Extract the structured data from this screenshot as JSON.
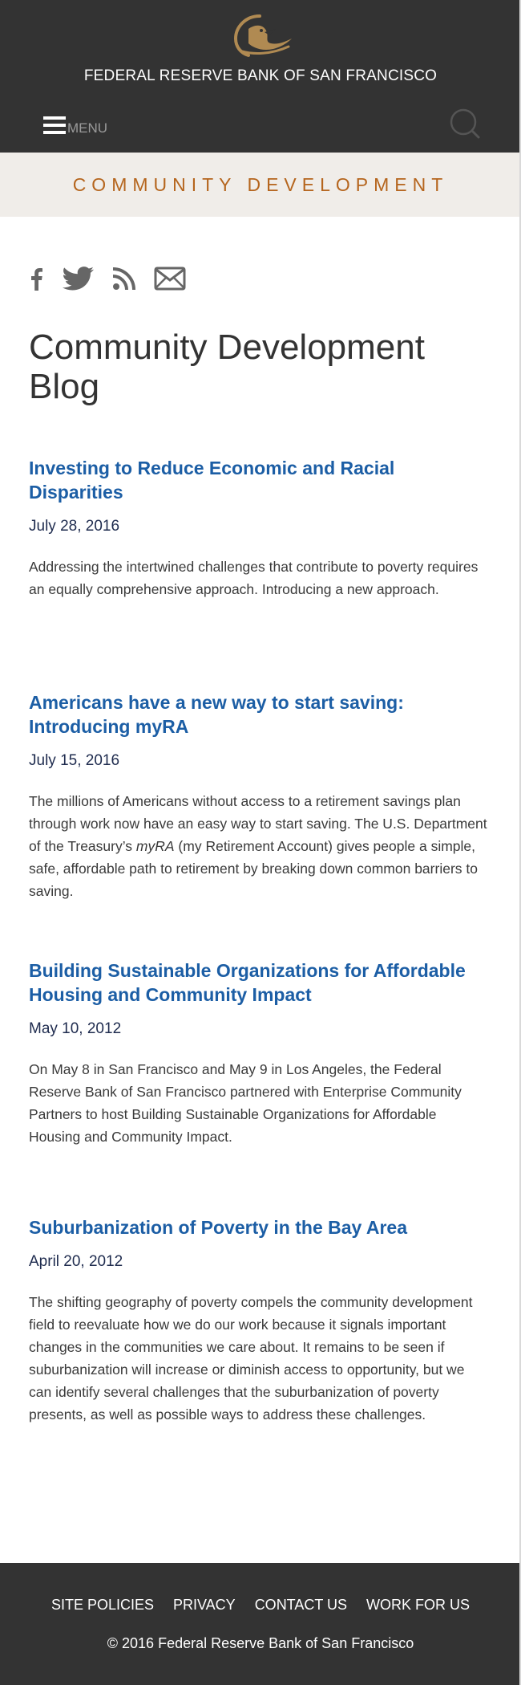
{
  "header": {
    "bank_name": "FEDERAL RESERVE BANK OF SAN FRANCISCO",
    "menu_label": "MENU",
    "logo_icon": "eagle-logo",
    "search_icon": "search-icon",
    "colors": {
      "background": "#333333",
      "logo": "#b08a52"
    }
  },
  "section": {
    "title": "COMMUNITY DEVELOPMENT",
    "colors": {
      "background": "#f0ede9",
      "text": "#b5651d"
    }
  },
  "social": {
    "icons": [
      "facebook-icon",
      "twitter-icon",
      "rss-icon",
      "email-icon"
    ]
  },
  "main": {
    "page_title": "Community Development Blog",
    "posts": [
      {
        "title": "Investing to Reduce Economic and Racial Disparities",
        "date": "July 28, 2016",
        "summary": "Addressing the intertwined challenges that contribute to poverty requires an equally comprehensive approach. Introducing a new approach."
      },
      {
        "title": "Americans have a new way to start saving: Introducing myRA",
        "date": "July 15, 2016",
        "summary_before": "The millions of Americans without access to a retirement savings plan through work now have an easy way to start saving. The U.S. Department of the Treasury’s ",
        "summary_em": "myRA",
        "summary_after": " (my Retirement Account) gives people a simple, safe, affordable path to retirement by breaking down common barriers to saving."
      },
      {
        "title": "Building Sustainable Organizations for Affordable Housing and Community Impact",
        "date": "May 10, 2012",
        "summary": "On May 8 in San Francisco and May 9 in Los Angeles, the Federal Reserve Bank of San Francisco partnered with Enterprise Community Partners to host Building Sustainable Organizations for Affordable Housing and Community Impact."
      },
      {
        "title": "Suburbanization of Poverty in the Bay Area",
        "date": "April 20, 2012",
        "summary": "The shifting geography of poverty compels the community development field to reevaluate how we do our work because it signals important changes in the communities we care about. It remains to be seen if suburbanization will increase or diminish access to opportunity, but we can identify several challenges that the suburbanization of poverty presents, as well as possible ways to address these challenges."
      }
    ],
    "colors": {
      "post_title": "#1c5ea5",
      "date": "#1e2b4e"
    }
  },
  "footer": {
    "links": [
      "SITE POLICIES",
      "PRIVACY",
      "CONTACT US",
      "WORK FOR US"
    ],
    "copyright": "© 2016 Federal Reserve Bank of San Francisco",
    "colors": {
      "background": "#333333",
      "text": "#ffffff"
    }
  }
}
